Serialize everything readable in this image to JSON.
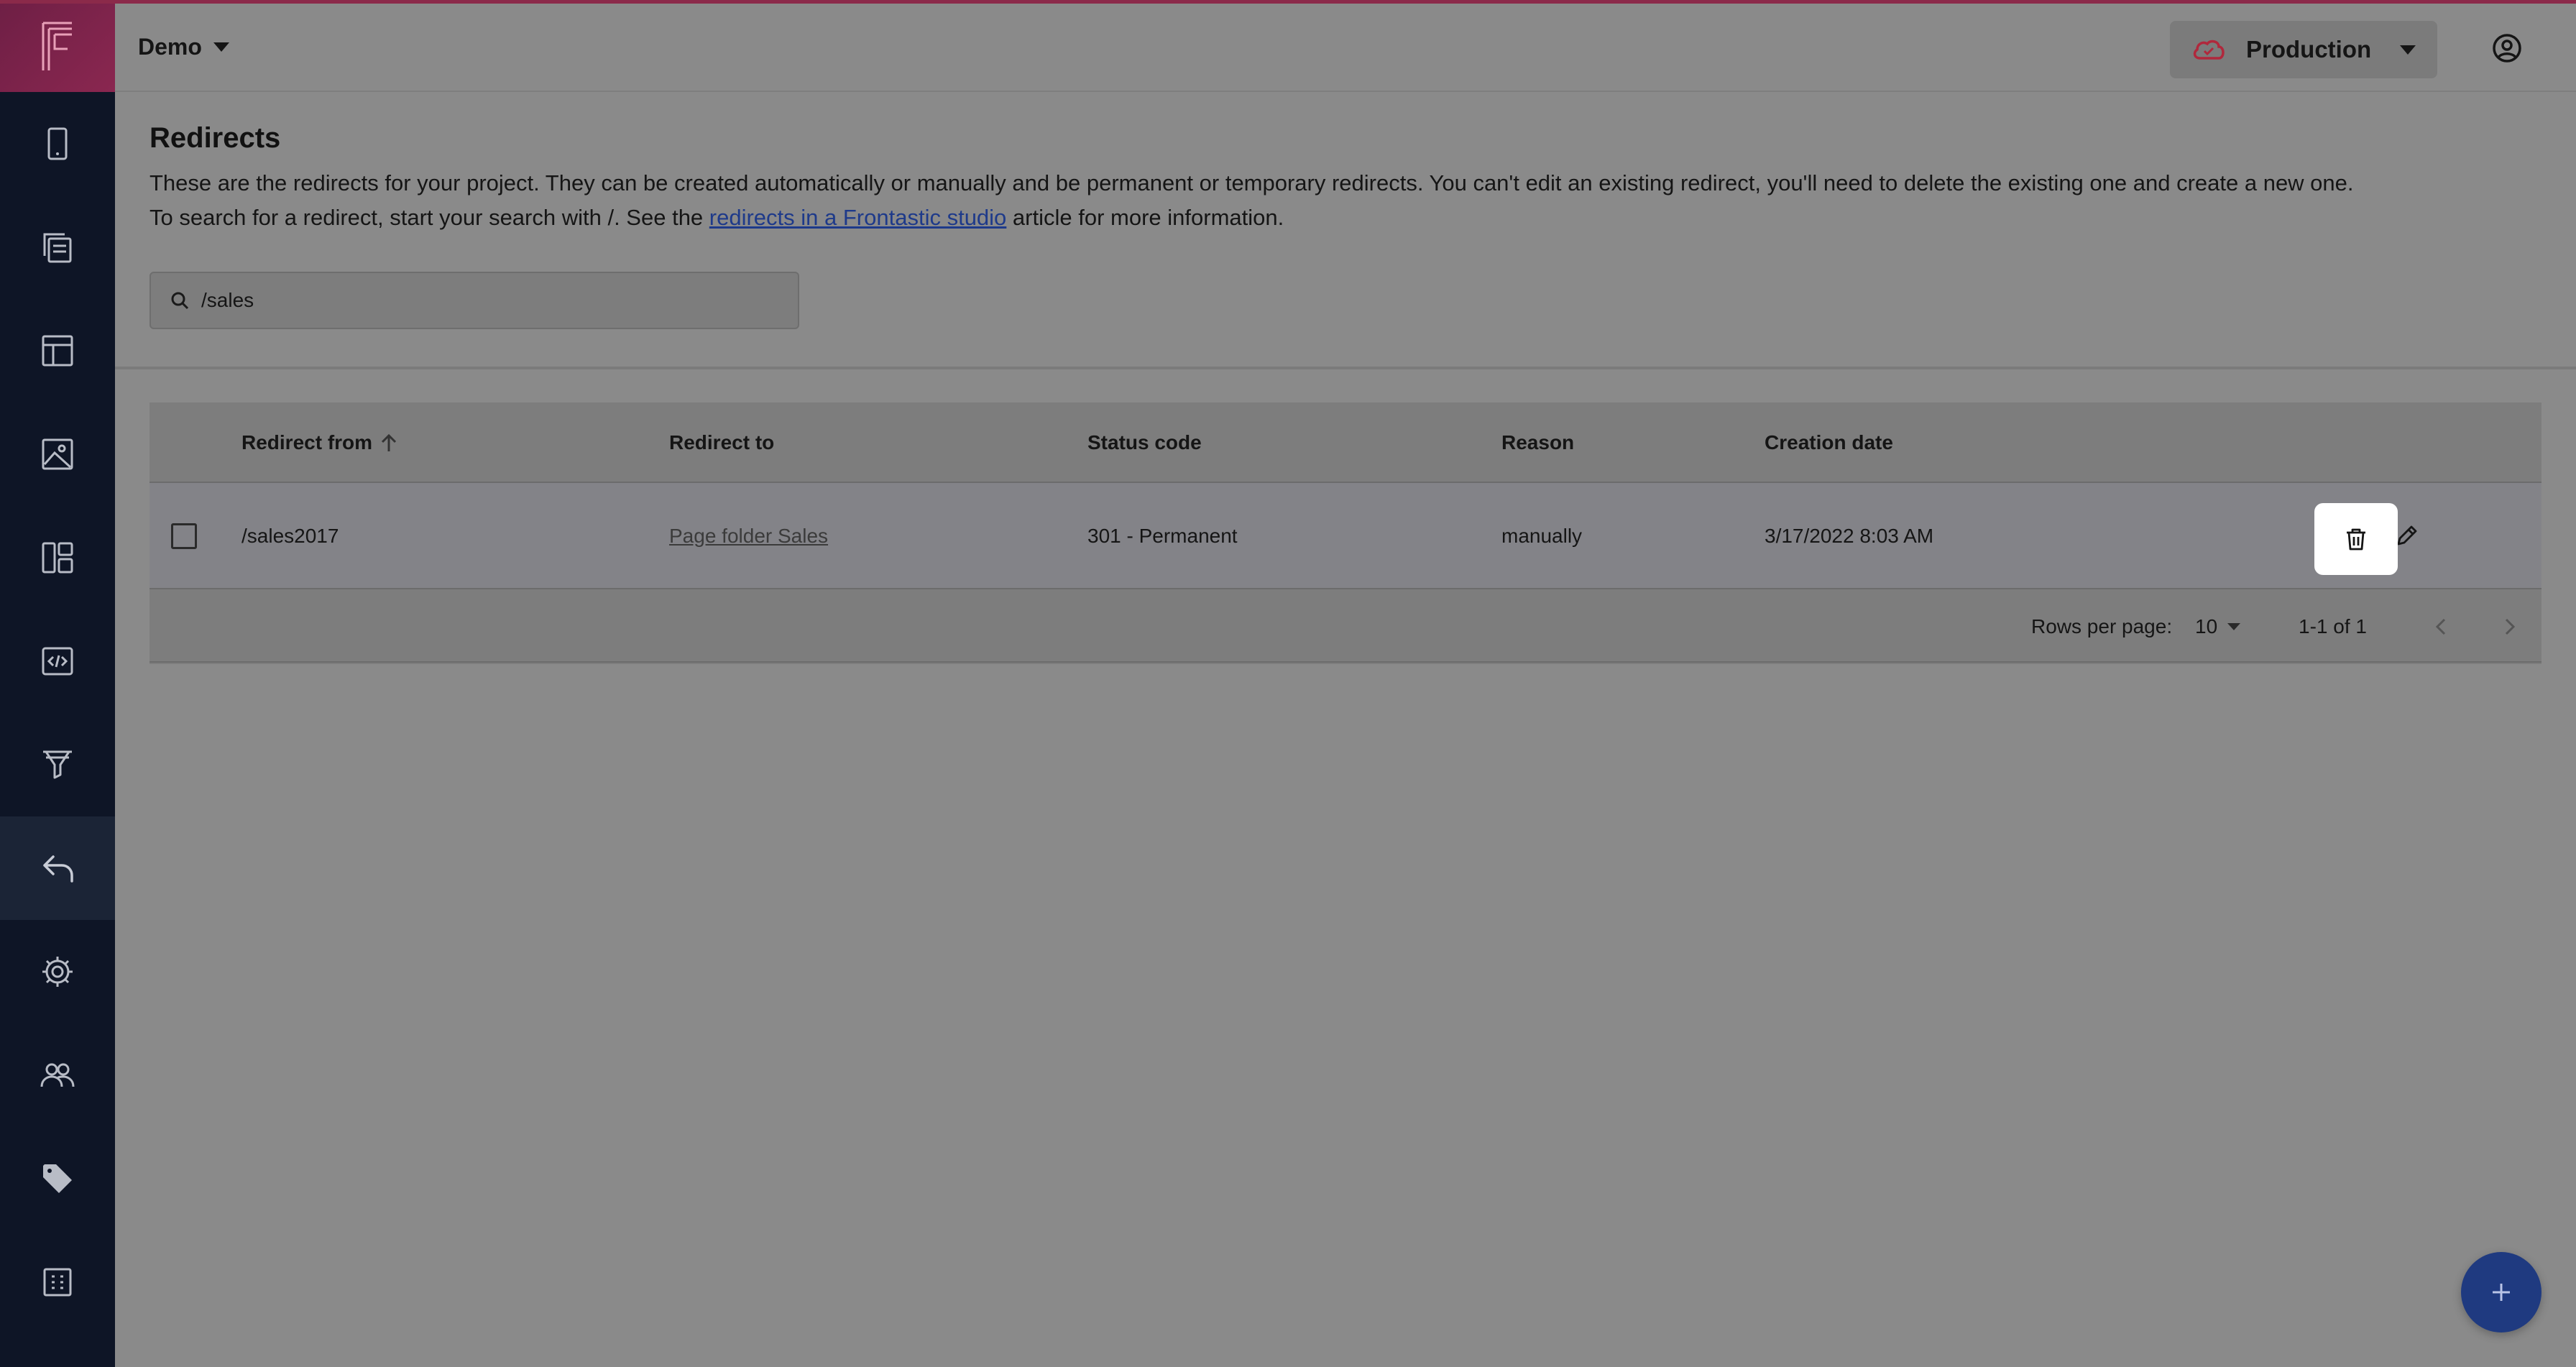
{
  "header": {
    "project_name": "Demo",
    "environment": "Production"
  },
  "page": {
    "title": "Redirects",
    "description_line1": "These are the redirects for your project. They can be created automatically or manually and be permanent or temporary redirects. You can't edit an existing redirect, you'll need to delete the existing one and create a new one.",
    "description_line2_prefix": "To search for a redirect, start your search with /. See the ",
    "description_link": "redirects in a Frontastic studio",
    "description_line2_suffix": " article for more information."
  },
  "search": {
    "value": "/sales"
  },
  "table": {
    "columns": {
      "redirect_from": "Redirect from",
      "redirect_to": "Redirect to",
      "status_code": "Status code",
      "reason": "Reason",
      "creation_date": "Creation date"
    },
    "rows": [
      {
        "redirect_from": "/sales2017",
        "redirect_to": "Page folder Sales",
        "status_code": "301 - Permanent",
        "reason": "manually",
        "creation_date": "3/17/2022 8:03 AM"
      }
    ]
  },
  "pagination": {
    "rows_per_page_label": "Rows per page:",
    "rows_per_page": "10",
    "range": "1-1 of 1"
  },
  "sidebar": {
    "items": [
      {
        "icon": "phone-icon"
      },
      {
        "icon": "pages-copy-icon"
      },
      {
        "icon": "layout-icon"
      },
      {
        "icon": "media-icon"
      },
      {
        "icon": "dashboard-icon"
      },
      {
        "icon": "code-icon"
      },
      {
        "icon": "funnel-icon"
      },
      {
        "icon": "redirect-icon",
        "active": true
      },
      {
        "icon": "gear-icon"
      },
      {
        "icon": "users-icon"
      },
      {
        "icon": "tag-icon"
      },
      {
        "icon": "apps-icon"
      }
    ]
  },
  "colors": {
    "sidebar": "#0e1526",
    "accent": "#8a2750",
    "link": "#1e3a8a",
    "fab": "#1f3a80"
  }
}
